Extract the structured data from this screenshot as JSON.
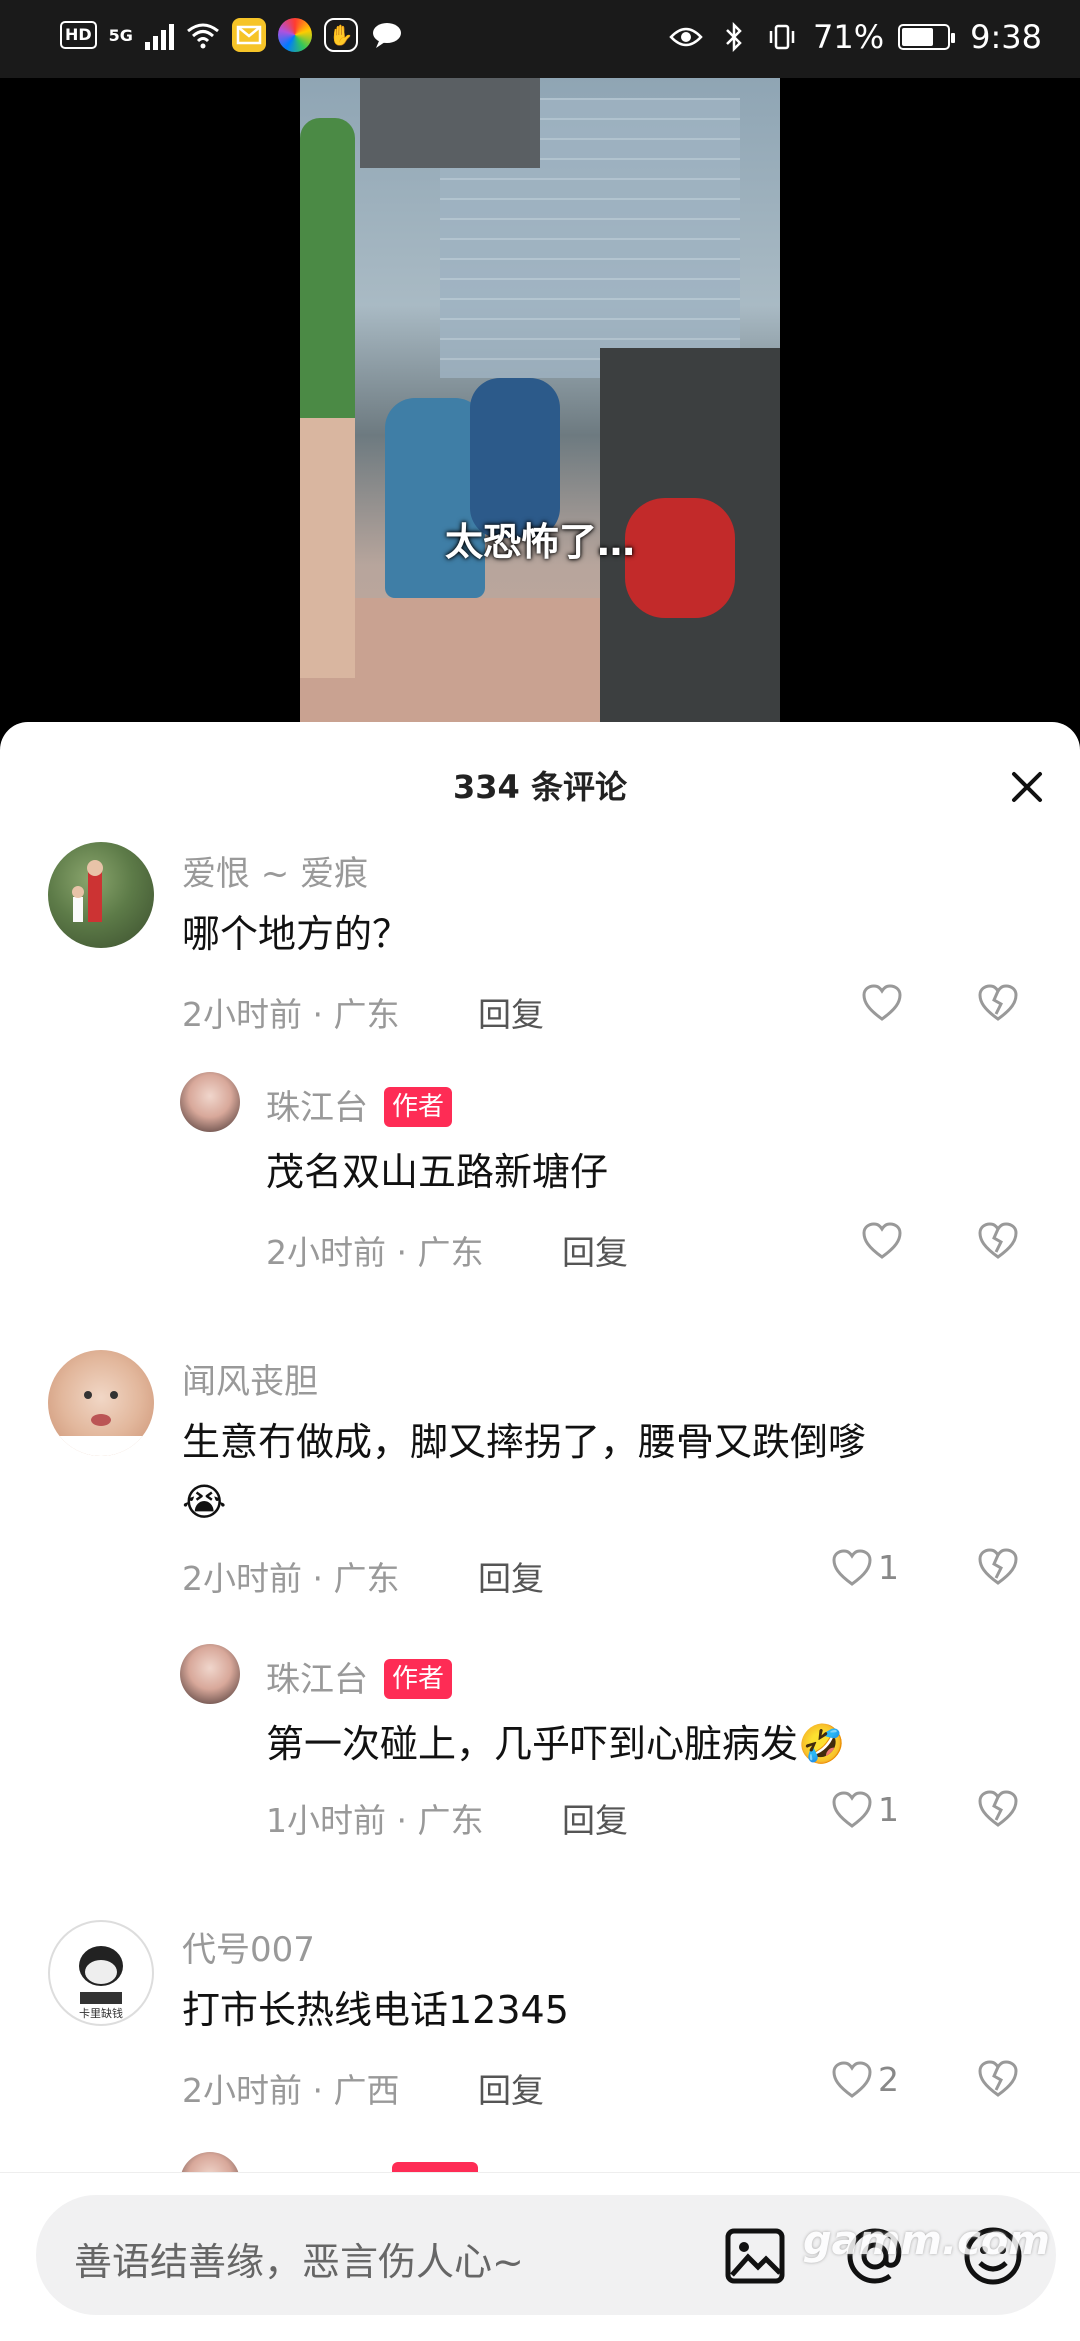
{
  "status_bar": {
    "hd_label": "HD",
    "network_label": "5G",
    "battery_percent": "71%",
    "battery_level": 0.71,
    "time": "9:38",
    "icons": [
      "hd-icon",
      "signal-icon",
      "wifi-icon",
      "mail-app-icon",
      "photo-app-icon",
      "hand-app-icon",
      "chat-app-icon",
      "eye-icon",
      "bluetooth-icon",
      "vibrate-icon",
      "battery-icon"
    ]
  },
  "video": {
    "overlay_text": "太恐怖了…"
  },
  "comments_sheet": {
    "title": "334 条评论",
    "close_icon": "close-icon",
    "reply_label": "回复",
    "author_tag": "作者",
    "comments": [
      {
        "user": "爱恨 ~ 爱痕",
        "text": "哪个地方的？",
        "meta": "2小时前 · 广东",
        "likes": "",
        "reply": {
          "user": "珠江台",
          "text": "茂名双山五路新塘仔",
          "meta": "2小时前 · 广东",
          "likes": ""
        }
      },
      {
        "user": "闻风丧胆",
        "text_line1": "生意冇做成，脚又摔拐了，腰骨又跌倒嗲",
        "text_line2_emoji": "😭",
        "meta": "2小时前 · 广东",
        "likes": "1",
        "reply": {
          "user": "珠江台",
          "text": "第一次碰上，几乎吓到心脏病发🤣",
          "meta": "1小时前 · 广东",
          "likes": "1"
        }
      },
      {
        "user": "代号007",
        "text": "打市长热线电话12345",
        "meta": "2小时前 · 广西",
        "likes": "2"
      }
    ]
  },
  "input_bar": {
    "placeholder": "善语结善缘，恶言伤人心~",
    "icons": [
      "image-icon",
      "at-icon",
      "emoji-icon"
    ]
  },
  "watermark": "gamm.com",
  "colors": {
    "accent": "#fe2c55",
    "muted_text": "#999999",
    "main_text": "#111111"
  }
}
